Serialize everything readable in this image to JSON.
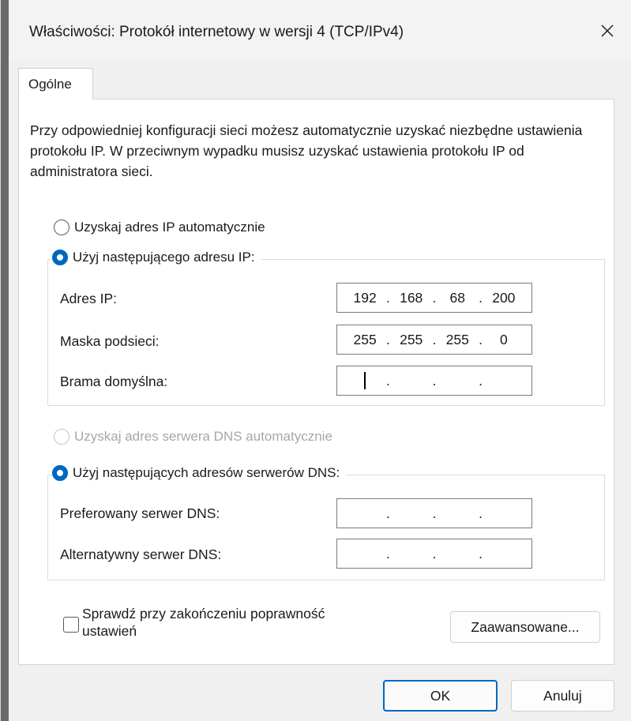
{
  "window": {
    "title": "Właściwości: Protokół internetowy w wersji 4 (TCP/IPv4)",
    "close_icon": "close-icon"
  },
  "tabs": [
    {
      "label": "Ogólne",
      "active": true
    }
  ],
  "intro_text": "Przy odpowiedniej konfiguracji sieci możesz automatycznie uzyskać niezbędne ustawienia protokołu IP. W przeciwnym wypadku musisz uzyskać ustawienia protokołu IP od administratora sieci.",
  "ip": {
    "auto_label": "Uzyskaj adres IP automatycznie",
    "auto_selected": false,
    "manual_label": "Użyj następującego adresu IP:",
    "manual_selected": true,
    "address": {
      "label": "Adres IP:",
      "octets": [
        "192",
        "168",
        "68",
        "200"
      ]
    },
    "mask": {
      "label": "Maska podsieci:",
      "octets": [
        "255",
        "255",
        "255",
        "0"
      ]
    },
    "gateway": {
      "label": "Brama domyślna:",
      "octets": [
        "",
        "",
        "",
        ""
      ]
    }
  },
  "dns": {
    "auto_label": "Uzyskaj adres serwera DNS automatycznie",
    "auto_selected": false,
    "auto_disabled": true,
    "manual_label": "Użyj następujących adresów serwerów DNS:",
    "manual_selected": true,
    "preferred": {
      "label": "Preferowany serwer DNS:",
      "octets": [
        "",
        "",
        "",
        ""
      ]
    },
    "alternate": {
      "label": "Alternatywny serwer DNS:",
      "octets": [
        "",
        "",
        "",
        ""
      ]
    }
  },
  "validate": {
    "label_line1": "Sprawdź przy zakończeniu poprawność",
    "label_line2": "ustawień",
    "checked": false
  },
  "buttons": {
    "advanced": "Zaawansowane...",
    "ok": "OK",
    "cancel": "Anuluj"
  },
  "colors": {
    "accent": "#0067c0"
  }
}
